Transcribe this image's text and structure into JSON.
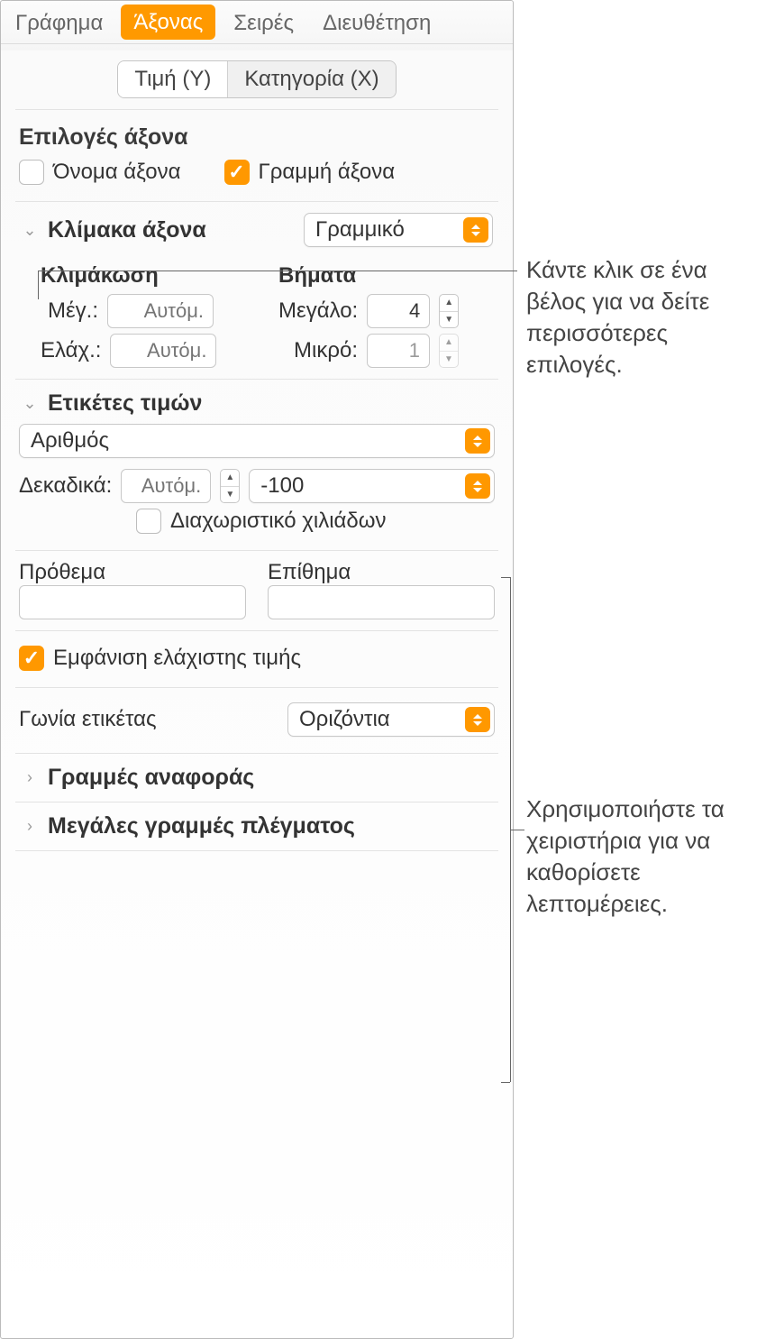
{
  "tabs": {
    "chart": "Γράφημα",
    "axis": "Άξονας",
    "series": "Σειρές",
    "arrange": "Διευθέτηση"
  },
  "axisSeg": {
    "y": "Τιμή (Y)",
    "x": "Κατηγορία (X)"
  },
  "axisOptions": {
    "title": "Επιλογές άξονα",
    "nameLabel": "Όνομα άξονα",
    "lineLabel": "Γραμμή άξονα"
  },
  "scale": {
    "title": "Κλίμακα άξονα",
    "type": "Γραμμικό",
    "scalingHdr": "Κλιμάκωση",
    "stepsHdr": "Βήματα",
    "maxLabel": "Μέγ.:",
    "minLabel": "Ελάχ.:",
    "autoPh": "Αυτόμ.",
    "majorLabel": "Μεγάλο:",
    "minorLabel": "Μικρό:",
    "majorVal": "4",
    "minorVal": "1"
  },
  "valueLabels": {
    "title": "Ετικέτες τιμών",
    "format": "Αριθμός",
    "decimalsLabel": "Δεκαδικά:",
    "decimalsPh": "Αυτόμ.",
    "negFmt": "-100",
    "thousandsLabel": "Διαχωριστικό χιλιάδων",
    "prefixLabel": "Πρόθεμα",
    "suffixLabel": "Επίθημα",
    "showMinLabel": "Εμφάνιση ελάχιστης τιμής",
    "angleLabel": "Γωνία ετικέτας",
    "angleValue": "Οριζόντια"
  },
  "refLines": "Γραμμές αναφοράς",
  "majorGrid": "Μεγάλες γραμμές πλέγματος",
  "annot1": "Κάντε κλικ σε ένα βέλος για να δείτε περισσότερες επιλογές.",
  "annot2": "Χρησιμοποιήστε τα χειριστήρια για να καθορίσετε λεπτομέρειες."
}
